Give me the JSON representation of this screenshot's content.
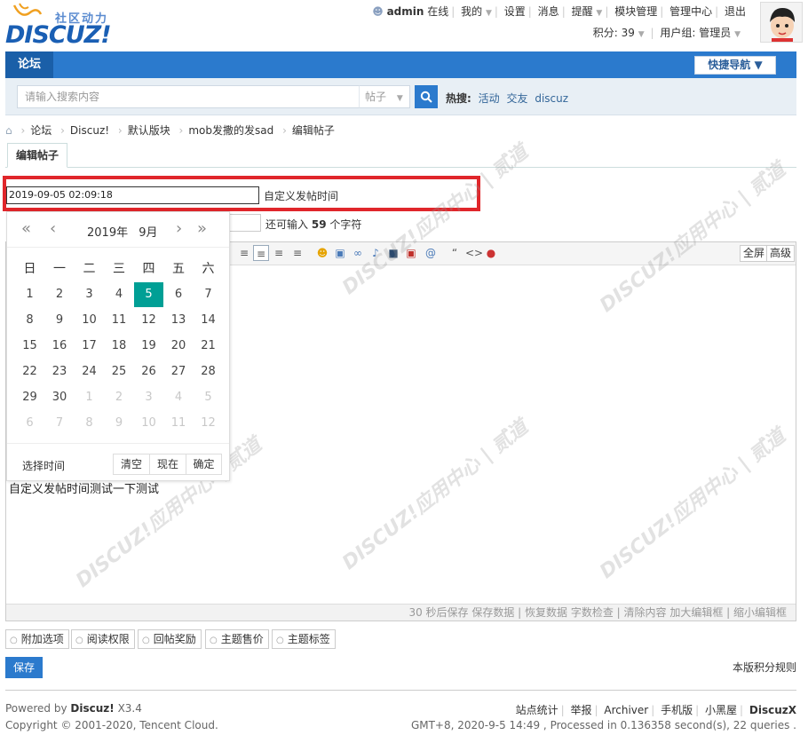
{
  "logo": {
    "sub": "社区动力",
    "main": "DISCUZ!"
  },
  "user_menu": {
    "username": "admin",
    "status": "在线",
    "my": "我的",
    "settings": "设置",
    "messages": "消息",
    "reminders": "提醒",
    "module_admin": "模块管理",
    "admin_center": "管理中心",
    "logout": "退出",
    "points": "积分: 39",
    "usergroup": "用户组: 管理员"
  },
  "nav": {
    "forum": "论坛",
    "quick_nav": "快捷导航 ▼"
  },
  "search": {
    "placeholder": "请输入搜索内容",
    "type": "帖子",
    "hot_label": "热搜:",
    "hot_words": [
      "活动",
      "交友",
      "discuz"
    ]
  },
  "breadcrumb": [
    "论坛",
    "Discuz!",
    "默认版块",
    "mob发撒的发sad",
    "编辑帖子"
  ],
  "tab": {
    "label": "编辑帖子"
  },
  "datetime": {
    "value": "2019-09-05 02:09:18",
    "label": "自定义发帖时间"
  },
  "subject": {
    "remain_prefix": "还可输入",
    "remain_count": "59",
    "remain_suffix": "个字符"
  },
  "calendar": {
    "year": "2019年",
    "month": "9月",
    "weekdays": [
      "日",
      "一",
      "二",
      "三",
      "四",
      "五",
      "六"
    ],
    "days": [
      [
        "1",
        "2",
        "3",
        "4",
        "5",
        "6",
        "7"
      ],
      [
        "8",
        "9",
        "10",
        "11",
        "12",
        "13",
        "14"
      ],
      [
        "15",
        "16",
        "17",
        "18",
        "19",
        "20",
        "21"
      ],
      [
        "22",
        "23",
        "24",
        "25",
        "26",
        "27",
        "28"
      ],
      [
        "29",
        "30",
        "1",
        "2",
        "3",
        "4",
        "5"
      ],
      [
        "6",
        "7",
        "8",
        "9",
        "10",
        "11",
        "12"
      ]
    ],
    "selected_day": "5",
    "choose_time": "选择时间",
    "clear": "清空",
    "now": "现在",
    "confirm": "确定"
  },
  "editor": {
    "fullscreen": "全屏",
    "advanced": "高级",
    "content": "自定义发帖时间测试一下测试",
    "status": "30 秒后保存 保存数据 | 恢复数据    字数检查 | 清除内容    加大编辑框 | 缩小编辑框"
  },
  "options": [
    "附加选项",
    "阅读权限",
    "回帖奖励",
    "主题售价",
    "主题标签"
  ],
  "save": "保存",
  "rules": "本版积分规则",
  "footer": {
    "powered_prefix": "Powered by",
    "powered_brand": "Discuz!",
    "version": "X3.4",
    "copyright": "Copyright © 2001-2020, Tencent Cloud.",
    "links": [
      "站点统计",
      "举报",
      "Archiver",
      "手机版",
      "小黑屋"
    ],
    "brand": "DiscuzX",
    "info": "GMT+8, 2020-9-5 14:49 , Processed in 0.136358 second(s), 22 queries ."
  },
  "watermark": "DISCUZ!应用中心 | 贰道"
}
